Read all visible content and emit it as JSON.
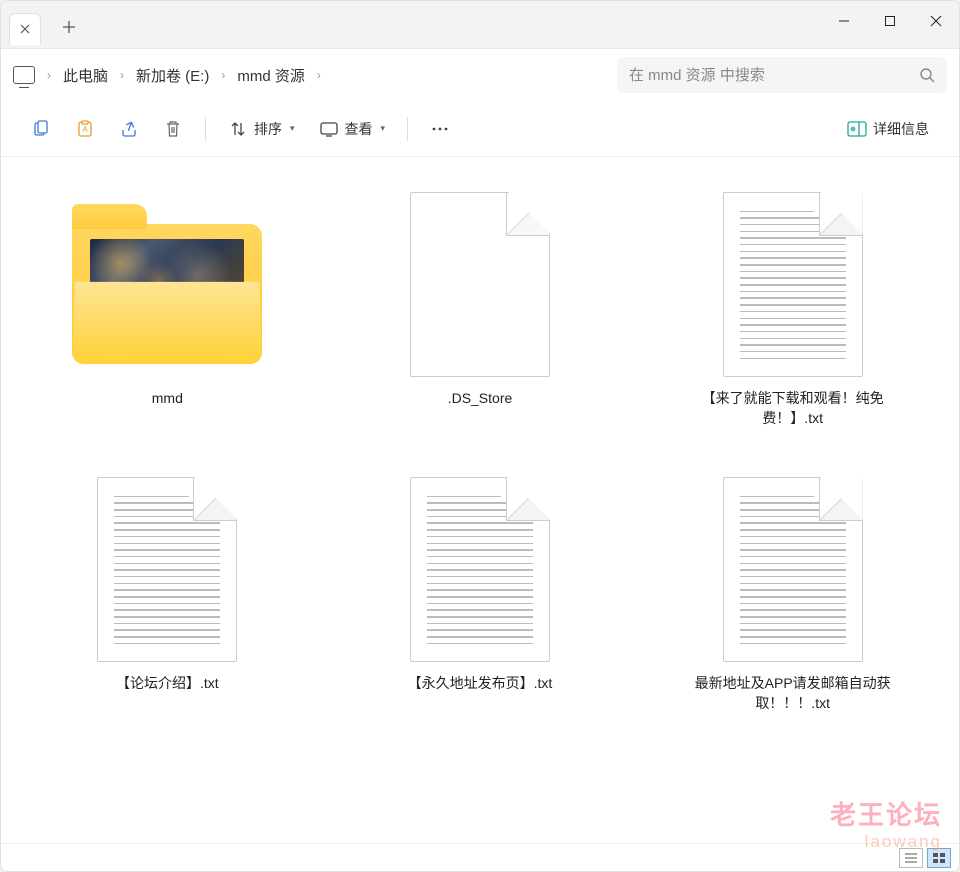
{
  "breadcrumb": [
    {
      "label": "此电脑"
    },
    {
      "label": "新加卷 (E:)"
    },
    {
      "label": "mmd 资源"
    }
  ],
  "search": {
    "placeholder": "在 mmd 资源 中搜索"
  },
  "toolbar": {
    "sort": "排序",
    "view": "查看",
    "details": "详细信息"
  },
  "items": [
    {
      "type": "folder",
      "label": "mmd"
    },
    {
      "type": "file",
      "label": ".DS_Store"
    },
    {
      "type": "text",
      "label": "【来了就能下载和观看！纯免费！】.txt"
    },
    {
      "type": "text",
      "label": "【论坛介绍】.txt"
    },
    {
      "type": "text",
      "label": "【永久地址发布页】.txt"
    },
    {
      "type": "text",
      "label": "最新地址及APP请发邮箱自动获取！！！.txt"
    }
  ],
  "watermark": {
    "line1": "老王论坛",
    "line2": "laowang"
  }
}
